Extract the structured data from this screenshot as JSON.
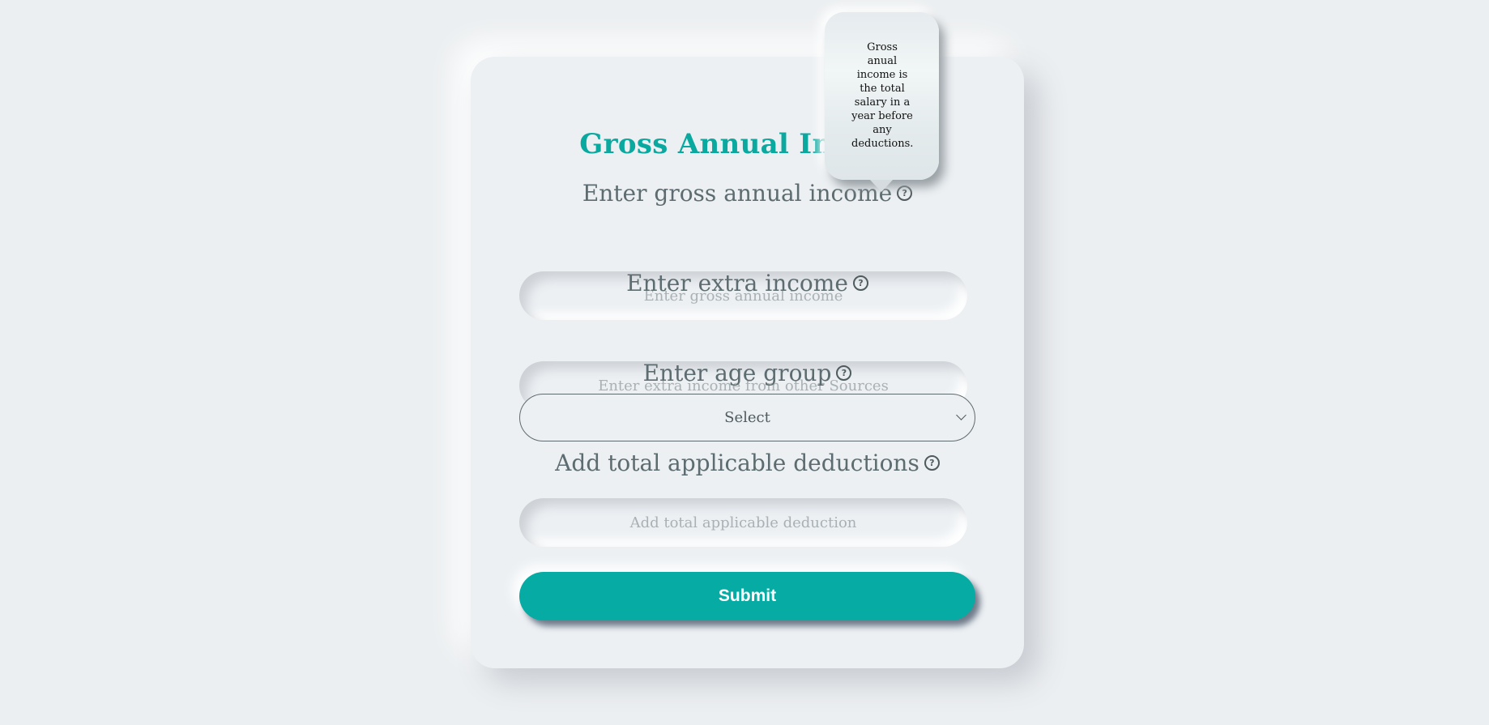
{
  "form": {
    "title": "Gross Annual Income",
    "gross_income": {
      "label": "Enter gross annual income",
      "placeholder": "Enter gross annual income",
      "help_icon": "question-circle-icon"
    },
    "extra_income": {
      "label": "Enter extra income",
      "placeholder": "Enter extra income from other Sources",
      "help_icon": "question-circle-icon"
    },
    "age_group": {
      "label": "Enter age group",
      "selected": "Select",
      "help_icon": "question-circle-icon",
      "dropdown_icon": "chevron-down-icon"
    },
    "deductions": {
      "label": "Add total applicable deductions",
      "placeholder": "Add total applicable deduction",
      "help_icon": "question-circle-icon"
    },
    "submit_label": "Submit"
  },
  "tooltip": {
    "text": "Gross anual income is the total salary in a year before any deductions."
  },
  "colors": {
    "accent": "#06aca3",
    "background": "#eceff1",
    "label": "#5d6c70"
  }
}
